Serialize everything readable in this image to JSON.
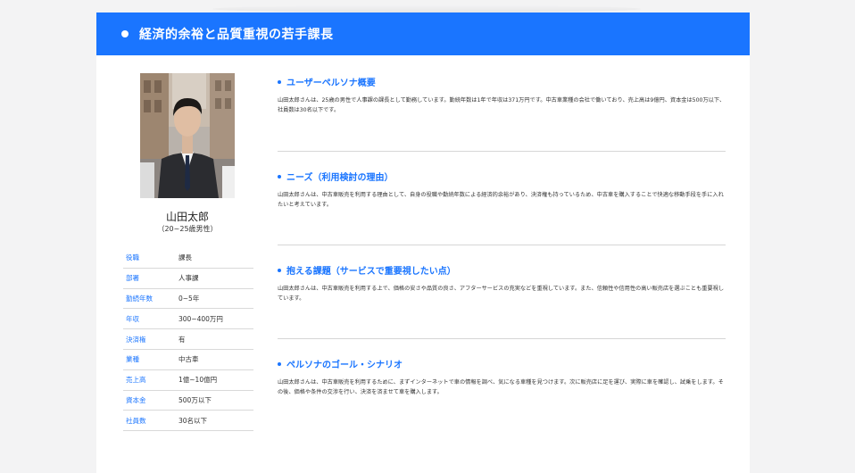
{
  "header": {
    "title": "経済的余裕と品質重視の若手課長"
  },
  "profile": {
    "name": "山田太郎",
    "age": "（20~25歳男性）",
    "attributes": [
      {
        "label": "役職",
        "value": "課長"
      },
      {
        "label": "部署",
        "value": "人事課"
      },
      {
        "label": "勤続年数",
        "value": "0~5年"
      },
      {
        "label": "年収",
        "value": "300~400万円"
      },
      {
        "label": "決済権",
        "value": "有"
      },
      {
        "label": "業種",
        "value": "中古車"
      },
      {
        "label": "売上高",
        "value": "1億~10億円"
      },
      {
        "label": "資本金",
        "value": "500万以下"
      },
      {
        "label": "社員数",
        "value": "30名以下"
      }
    ]
  },
  "sections": [
    {
      "title": "ユーザーペルソナ概要",
      "text": "山田太郎さんは、25歳の男性で人事課の課長として勤務しています。勤続年数は1年で年収は371万円です。中古車業種の会社で働いており、売上高は9億円、資本金は500万以下、社員数は30名以下です。"
    },
    {
      "title": "ニーズ（利用検討の理由）",
      "text": "山田太郎さんは、中古車販売を利用する理由として、自身の役職や勤続年数による経済的余裕があり、決済権も持っているため、中古車を購入することで快適な移動手段を手に入れたいと考えています。"
    },
    {
      "title": "抱える課題（サービスで重要視したい点）",
      "text": "山田太郎さんは、中古車販売を利用する上で、価格の安さや品質の良さ、アフターサービスの充実などを重視しています。また、信頼性や信用性の高い販売店を選ぶことも重要視しています。"
    },
    {
      "title": "ペルソナのゴール・シナリオ",
      "text": "山田太郎さんは、中古車販売を利用するために、まずインターネットで車の情報を調べ、気になる車種を見つけます。次に販売店に足を運び、実際に車を確認し、試乗をします。その後、価格や条件の交渉を行い、決済を済ませて車を購入します。"
    }
  ]
}
